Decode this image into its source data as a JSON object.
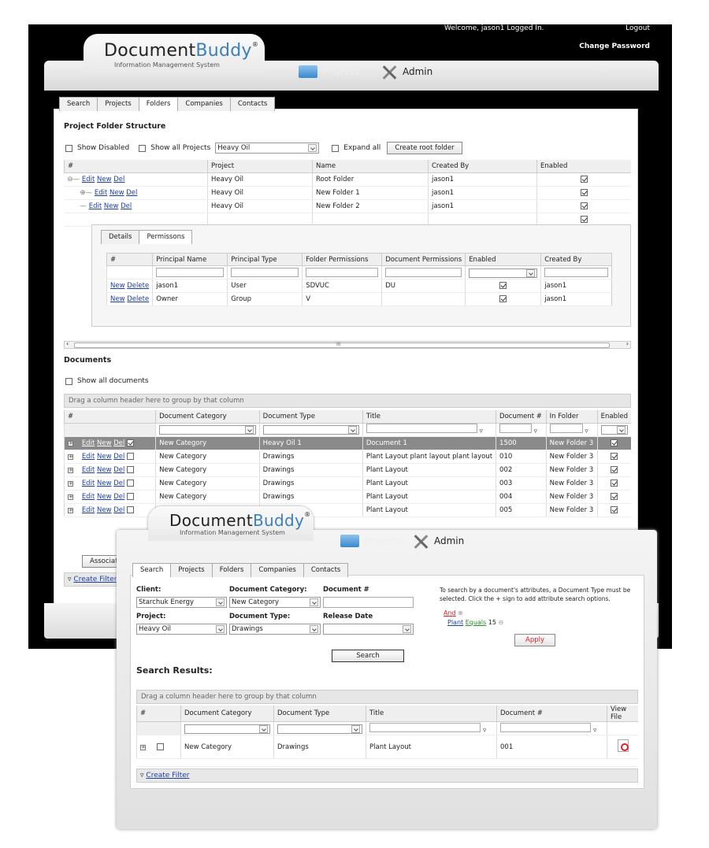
{
  "win1": {
    "welcome": "Welcome, jason1 Logged In.",
    "logout": "Logout",
    "change_password": "Change Password",
    "logo_main": "Document",
    "logo_accent": "Buddy",
    "logo_reg": "®",
    "logo_sub": "Information Management System",
    "nav_projects": "Projects",
    "nav_admin": "Admin",
    "tabs": [
      "Search",
      "Projects",
      "Folders",
      "Companies",
      "Contacts"
    ],
    "section_title": "Project Folder Structure",
    "show_disabled": "Show Disabled",
    "show_all_projects": "Show all Projects",
    "project_select": "Heavy Oil",
    "expand_all": "Expand all",
    "create_root": "Create root folder",
    "folder_cols": [
      "#",
      "Project",
      "Name",
      "Created By",
      "Enabled"
    ],
    "folder_rows": [
      {
        "actions": [
          "Edit",
          "New",
          "Del"
        ],
        "project": "Heavy Oil",
        "name": "Root Folder",
        "created": "jason1"
      },
      {
        "actions": [
          "Edit",
          "New",
          "Del"
        ],
        "project": "Heavy Oil",
        "name": "New Folder 1",
        "created": "jason1"
      },
      {
        "actions": [
          "Edit",
          "New",
          "Del"
        ],
        "project": "Heavy Oil",
        "name": "New Folder 2",
        "created": "jason1"
      }
    ],
    "sub_tabs": [
      "Details",
      "Permissons"
    ],
    "perm_cols": [
      "#",
      "Principal Name",
      "Principal Type",
      "Folder Permissions",
      "Document Permissions",
      "Enabled",
      "Created By"
    ],
    "perm_rows": [
      {
        "new": "New",
        "del": "Delete",
        "name": "jason1",
        "type": "User",
        "fperm": "SDVUC",
        "dperm": "DU",
        "created": "jason1"
      },
      {
        "new": "New",
        "del": "Delete",
        "name": "Owner",
        "type": "Group",
        "fperm": "V",
        "dperm": "",
        "created": "jason1"
      }
    ],
    "scroll_mid": "III",
    "documents_title": "Documents",
    "show_all_docs": "Show all documents",
    "group_hint": "Drag a column header here to group by that column",
    "doc_cols": [
      "#",
      "Document Category",
      "Document Type",
      "Title",
      "Document #",
      "In Folder",
      "Enabled"
    ],
    "doc_rows": [
      {
        "cat": "New Category",
        "type": "Heavy Oil 1",
        "title": "Document 1",
        "num": "1500",
        "folder": "New Folder 3"
      },
      {
        "cat": "New Category",
        "type": "Drawings",
        "title": "Plant Layout plant layout plant layout",
        "num": "010",
        "folder": "New Folder 3"
      },
      {
        "cat": "New Category",
        "type": "Drawings",
        "title": "Plant Layout",
        "num": "002",
        "folder": "New Folder 3"
      },
      {
        "cat": "New Category",
        "type": "Drawings",
        "title": "Plant Layout",
        "num": "003",
        "folder": "New Folder 3"
      },
      {
        "cat": "New Category",
        "type": "Drawings",
        "title": "Plant Layout",
        "num": "004",
        "folder": "New Folder 3"
      },
      {
        "cat": "New Category",
        "type": "Drawings",
        "title": "Plant Layout",
        "num": "005",
        "folder": "New Folder 3"
      }
    ],
    "row_edit": "Edit",
    "row_new": "New",
    "row_del": "Del",
    "associate": "Associate",
    "create_filter": "Create Filter"
  },
  "win2": {
    "logo_main": "Document",
    "logo_accent": "Buddy",
    "logo_reg": "®",
    "logo_sub": "Information Management System",
    "nav_projects": "Projects",
    "nav_admin": "Admin",
    "tabs": [
      "Search",
      "Projects",
      "Folders",
      "Companies",
      "Contacts"
    ],
    "client_label": "Client:",
    "client_value": "Starchuk Energy",
    "doc_cat_label": "Document Category:",
    "doc_cat_value": "New Category",
    "doc_num_label": "Document #",
    "project_label": "Project:",
    "project_value": "Heavy Oil",
    "doc_type_label": "Document Type:",
    "doc_type_value": "Drawings",
    "release_label": "Release Date",
    "help_text": "To search by a document's attributes, a Document Type must be selected. Click the + sign to add attribute search options.",
    "and_label": "And",
    "attr_name": "Plant",
    "attr_op": "Equals",
    "attr_val": "15",
    "apply": "Apply",
    "search": "Search",
    "results_title": "Search Results:",
    "group_hint": "Drag a column header here to group by that column",
    "res_cols": [
      "#",
      "Document Category",
      "Document Type",
      "Title",
      "Document #",
      "View File"
    ],
    "res_row": {
      "cat": "New Category",
      "type": "Drawings",
      "title": "Plant Layout",
      "num": "001"
    },
    "create_filter": "Create Filter"
  },
  "colors": {
    "accent": "#3e7fb8",
    "link": "#1a3fa8",
    "highlight": "#8a8a8a",
    "apply": "#d22"
  }
}
